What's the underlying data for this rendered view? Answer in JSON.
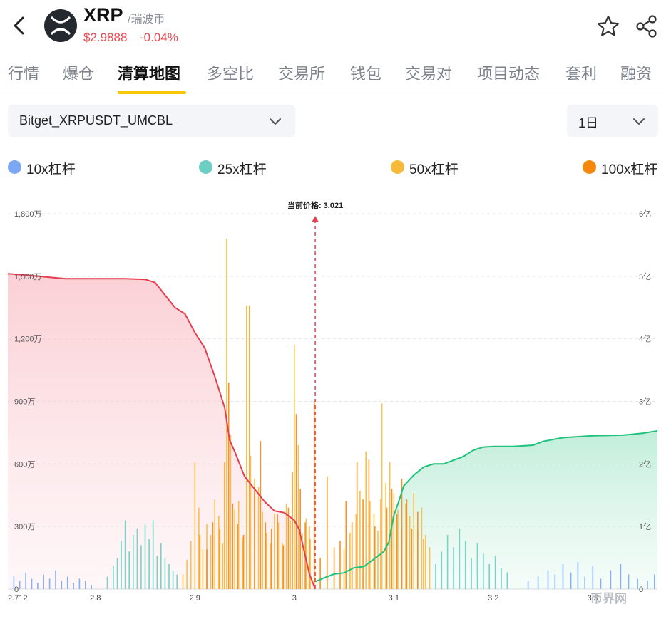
{
  "header": {
    "symbol": "XRP",
    "name_cn": "/瑞波币",
    "price": "$2.9888",
    "change": "-0.04%",
    "logo_icon": "xrp-logo-icon",
    "back_icon": "chevron-left-icon",
    "star_icon": "star-icon",
    "share_icon": "share-icon"
  },
  "tabs": [
    {
      "label": "行情",
      "active": false
    },
    {
      "label": "爆仓",
      "active": false
    },
    {
      "label": "清算地图",
      "active": true
    },
    {
      "label": "多空比",
      "active": false
    },
    {
      "label": "交易所",
      "active": false
    },
    {
      "label": "钱包",
      "active": false
    },
    {
      "label": "交易对",
      "active": false
    },
    {
      "label": "项目动态",
      "active": false
    },
    {
      "label": "套利",
      "active": false
    },
    {
      "label": "融资",
      "active": false
    }
  ],
  "filters": {
    "exchange_pair": "Bitget_XRPUSDT_UMCBL",
    "period": "1日"
  },
  "legend": [
    {
      "label": "10x杠杆",
      "color": "#7ba7f5"
    },
    {
      "label": "25x杠杆",
      "color": "#6ccfc3"
    },
    {
      "label": "50x杠杆",
      "color": "#f7b93a"
    },
    {
      "label": "100x杠杆",
      "color": "#f5870f"
    }
  ],
  "watermark": "币界网",
  "chart_data": {
    "type": "bar",
    "current_price_label": "当前价格: 3.021",
    "current_price": 3.021,
    "x_ticks": [
      "2.712",
      "2.8",
      "2.9",
      "3",
      "3.1",
      "3.2",
      "3.3"
    ],
    "x_range": [
      2.712,
      3.365
    ],
    "left_axis": {
      "ticks": [
        "0",
        "300万",
        "600万",
        "900万",
        "1,200万",
        "1,500万",
        "1,800万"
      ],
      "range": [
        0,
        18000000
      ]
    },
    "right_axis": {
      "ticks": [
        "0",
        "1亿",
        "2亿",
        "3亿",
        "4亿",
        "5亿",
        "6亿"
      ],
      "range": [
        0,
        600000000
      ]
    },
    "grid": true,
    "series": [
      {
        "name": "10x杠杆",
        "color": "#7ba7f5",
        "bars": [
          [
            2.718,
            600000
          ],
          [
            2.724,
            400000
          ],
          [
            2.73,
            800000
          ],
          [
            2.736,
            500000
          ],
          [
            2.742,
            300000
          ],
          [
            2.748,
            700000
          ],
          [
            2.754,
            500000
          ],
          [
            2.76,
            900000
          ],
          [
            2.766,
            400000
          ],
          [
            2.772,
            600000
          ],
          [
            2.778,
            300000
          ],
          [
            2.784,
            500000
          ],
          [
            2.79,
            400000
          ],
          [
            2.796,
            200000
          ],
          [
            3.235,
            400000
          ],
          [
            3.245,
            600000
          ],
          [
            3.255,
            900000
          ],
          [
            3.262,
            700000
          ],
          [
            3.27,
            1200000
          ],
          [
            3.278,
            800000
          ],
          [
            3.285,
            1300000
          ],
          [
            3.292,
            600000
          ],
          [
            3.3,
            1100000
          ],
          [
            3.308,
            500000
          ],
          [
            3.318,
            900000
          ],
          [
            3.328,
            1200000
          ],
          [
            3.336,
            700000
          ],
          [
            3.345,
            500000
          ],
          [
            3.355,
            400000
          ],
          [
            3.362,
            700000
          ]
        ]
      },
      {
        "name": "25x杠杆",
        "color": "#6ccfc3",
        "bars": [
          [
            2.812,
            600000
          ],
          [
            2.818,
            1100000
          ],
          [
            2.822,
            1500000
          ],
          [
            2.826,
            2300000
          ],
          [
            2.83,
            3300000
          ],
          [
            2.834,
            1800000
          ],
          [
            2.838,
            2600000
          ],
          [
            2.842,
            2900000
          ],
          [
            2.846,
            2100000
          ],
          [
            2.85,
            3100000
          ],
          [
            2.854,
            2400000
          ],
          [
            2.858,
            3300000
          ],
          [
            2.862,
            1600000
          ],
          [
            2.866,
            2200000
          ],
          [
            2.87,
            1500000
          ],
          [
            2.874,
            1200000
          ],
          [
            2.878,
            900000
          ],
          [
            2.882,
            700000
          ],
          [
            3.142,
            1200000
          ],
          [
            3.148,
            1800000
          ],
          [
            3.154,
            2600000
          ],
          [
            3.16,
            2000000
          ],
          [
            3.166,
            2900000
          ],
          [
            3.172,
            2300000
          ],
          [
            3.178,
            1500000
          ],
          [
            3.184,
            2200000
          ],
          [
            3.19,
            1700000
          ],
          [
            3.196,
            1200000
          ],
          [
            3.202,
            1600000
          ],
          [
            3.208,
            1000000
          ],
          [
            3.214,
            800000
          ]
        ]
      },
      {
        "name": "50x杠杆",
        "color": "#f7b93a",
        "bars": [
          [
            2.888,
            700000
          ],
          [
            2.892,
            1400000
          ],
          [
            2.896,
            2300000
          ],
          [
            2.9,
            6100000
          ],
          [
            2.904,
            3900000
          ],
          [
            2.908,
            1900000
          ],
          [
            2.912,
            3100000
          ],
          [
            2.916,
            2600000
          ],
          [
            2.92,
            4300000
          ],
          [
            2.924,
            3500000
          ],
          [
            2.928,
            2200000
          ],
          [
            2.932,
            16800000
          ],
          [
            2.936,
            7400000
          ],
          [
            2.94,
            3800000
          ],
          [
            2.944,
            4200000
          ],
          [
            2.948,
            2500000
          ],
          [
            2.952,
            13600000
          ],
          [
            2.956,
            6400000
          ],
          [
            2.96,
            5300000
          ],
          [
            2.964,
            4900000
          ],
          [
            2.968,
            3700000
          ],
          [
            2.972,
            2700000
          ],
          [
            2.976,
            2200000
          ],
          [
            2.98,
            3600000
          ],
          [
            2.984,
            3200000
          ],
          [
            2.988,
            2200000
          ],
          [
            2.992,
            4100000
          ],
          [
            2.996,
            3300000
          ],
          [
            3.0,
            11700000
          ],
          [
            3.004,
            6900000
          ],
          [
            3.008,
            2700000
          ],
          [
            3.012,
            3400000
          ],
          [
            3.016,
            2400000
          ],
          [
            3.05,
            1900000
          ],
          [
            3.056,
            2700000
          ],
          [
            3.062,
            3600000
          ],
          [
            3.066,
            4700000
          ],
          [
            3.072,
            6600000
          ],
          [
            3.076,
            4200000
          ],
          [
            3.08,
            3600000
          ],
          [
            3.084,
            2800000
          ],
          [
            3.088,
            8900000
          ],
          [
            3.092,
            5100000
          ],
          [
            3.096,
            6100000
          ],
          [
            3.1,
            4600000
          ],
          [
            3.104,
            3800000
          ],
          [
            3.108,
            2900000
          ],
          [
            3.112,
            4100000
          ],
          [
            3.116,
            3500000
          ],
          [
            3.12,
            4600000
          ],
          [
            3.124,
            2900000
          ],
          [
            3.128,
            3900000
          ],
          [
            3.132,
            2600000
          ],
          [
            3.136,
            2000000
          ]
        ]
      },
      {
        "name": "100x杠杆",
        "color": "#f5870f",
        "bars": [
          [
            2.905,
            2600000
          ],
          [
            2.912,
            1900000
          ],
          [
            2.918,
            3200000
          ],
          [
            2.925,
            2900000
          ],
          [
            2.93,
            6100000
          ],
          [
            2.934,
            9900000
          ],
          [
            2.938,
            4100000
          ],
          [
            2.943,
            3100000
          ],
          [
            2.949,
            2600000
          ],
          [
            2.955,
            13600000
          ],
          [
            2.96,
            4900000
          ],
          [
            2.966,
            7100000
          ],
          [
            2.971,
            3200000
          ],
          [
            2.977,
            2900000
          ],
          [
            2.983,
            3600000
          ],
          [
            2.989,
            2100000
          ],
          [
            2.994,
            3900000
          ],
          [
            2.998,
            5600000
          ],
          [
            3.002,
            8400000
          ],
          [
            3.006,
            4800000
          ],
          [
            3.011,
            3200000
          ],
          [
            3.015,
            3000000
          ],
          [
            3.02,
            9000000
          ],
          [
            3.026,
            1500000
          ],
          [
            3.033,
            5400000
          ],
          [
            3.04,
            2000000
          ],
          [
            3.046,
            2300000
          ],
          [
            3.052,
            4200000
          ],
          [
            3.058,
            3200000
          ],
          [
            3.063,
            6100000
          ],
          [
            3.069,
            4300000
          ],
          [
            3.075,
            6200000
          ],
          [
            3.081,
            3000000
          ],
          [
            3.087,
            4300000
          ],
          [
            3.093,
            3900000
          ],
          [
            3.098,
            4800000
          ],
          [
            3.103,
            3600000
          ],
          [
            3.108,
            5300000
          ],
          [
            3.113,
            4300000
          ],
          [
            3.118,
            2900000
          ],
          [
            3.124,
            3700000
          ],
          [
            3.13,
            2400000
          ]
        ]
      }
    ],
    "cumulative_short_curve": {
      "name": "",
      "color": "#e63e4f",
      "axis": "right",
      "points": [
        [
          2.712,
          504000000
        ],
        [
          2.73,
          502000000
        ],
        [
          2.75,
          499000000
        ],
        [
          2.77,
          496000000
        ],
        [
          2.8,
          496000000
        ],
        [
          2.83,
          496000000
        ],
        [
          2.85,
          495000000
        ],
        [
          2.86,
          490000000
        ],
        [
          2.87,
          470000000
        ],
        [
          2.88,
          450000000
        ],
        [
          2.89,
          440000000
        ],
        [
          2.9,
          410000000
        ],
        [
          2.91,
          385000000
        ],
        [
          2.92,
          340000000
        ],
        [
          2.93,
          290000000
        ],
        [
          2.935,
          238000000
        ],
        [
          2.94,
          220000000
        ],
        [
          2.95,
          180000000
        ],
        [
          2.96,
          160000000
        ],
        [
          2.97,
          140000000
        ],
        [
          2.98,
          125000000
        ],
        [
          2.99,
          122000000
        ],
        [
          3.0,
          110000000
        ],
        [
          3.005,
          95000000
        ],
        [
          3.01,
          60000000
        ],
        [
          3.015,
          25000000
        ],
        [
          3.021,
          0
        ]
      ]
    },
    "cumulative_long_curve": {
      "name": "",
      "color": "#1ec27a",
      "axis": "right",
      "points": [
        [
          3.021,
          12000000
        ],
        [
          3.03,
          18000000
        ],
        [
          3.04,
          24000000
        ],
        [
          3.05,
          26000000
        ],
        [
          3.055,
          30000000
        ],
        [
          3.06,
          34000000
        ],
        [
          3.07,
          36000000
        ],
        [
          3.08,
          48000000
        ],
        [
          3.09,
          60000000
        ],
        [
          3.095,
          75000000
        ],
        [
          3.1,
          118000000
        ],
        [
          3.105,
          140000000
        ],
        [
          3.11,
          165000000
        ],
        [
          3.12,
          182000000
        ],
        [
          3.13,
          195000000
        ],
        [
          3.14,
          200000000
        ],
        [
          3.15,
          200000000
        ],
        [
          3.16,
          206000000
        ],
        [
          3.17,
          212000000
        ],
        [
          3.18,
          222000000
        ],
        [
          3.19,
          227000000
        ],
        [
          3.2,
          228000000
        ],
        [
          3.22,
          228000000
        ],
        [
          3.24,
          230000000
        ],
        [
          3.25,
          236000000
        ],
        [
          3.27,
          242000000
        ],
        [
          3.3,
          245000000
        ],
        [
          3.33,
          246000000
        ],
        [
          3.35,
          249000000
        ],
        [
          3.365,
          253000000
        ]
      ]
    }
  }
}
